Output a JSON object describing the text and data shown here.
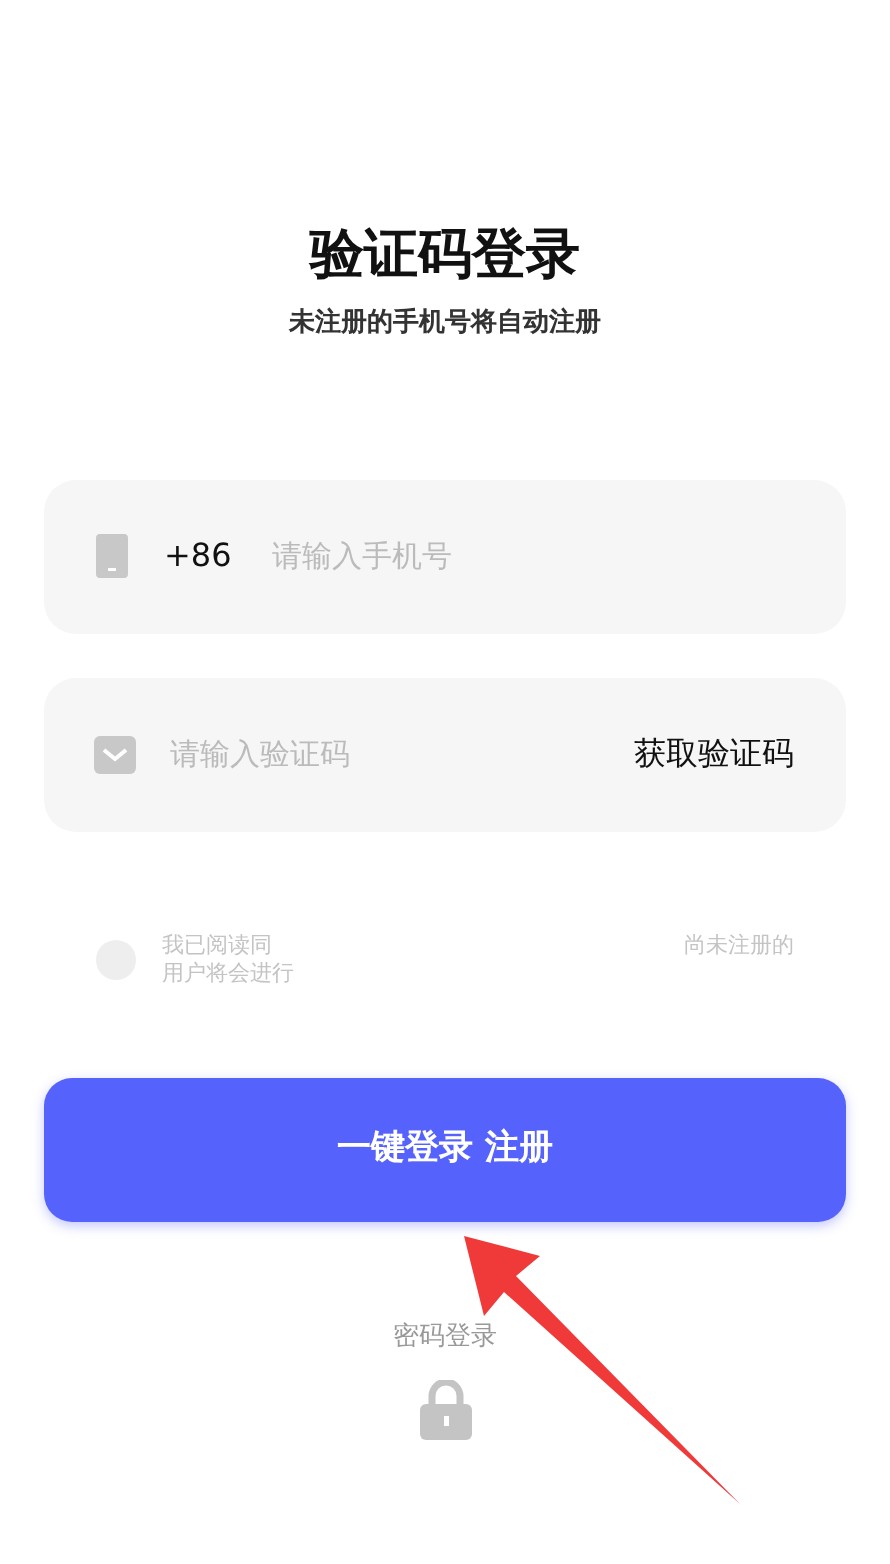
{
  "header": {
    "title": "验证码登录",
    "subtitle": "未注册的手机号将自动注册"
  },
  "phone_field": {
    "country_code": "+86",
    "placeholder": "请输入手机号"
  },
  "code_field": {
    "placeholder": "请输入验证码",
    "action": "获取验证码"
  },
  "agreement": {
    "checked": false,
    "line_start": "我已阅读同",
    "line_end": "尚未注册的",
    "line_2": "用户将会进行"
  },
  "primary_button": "一键登录 注册",
  "alt_login": {
    "label": "密码登录"
  }
}
